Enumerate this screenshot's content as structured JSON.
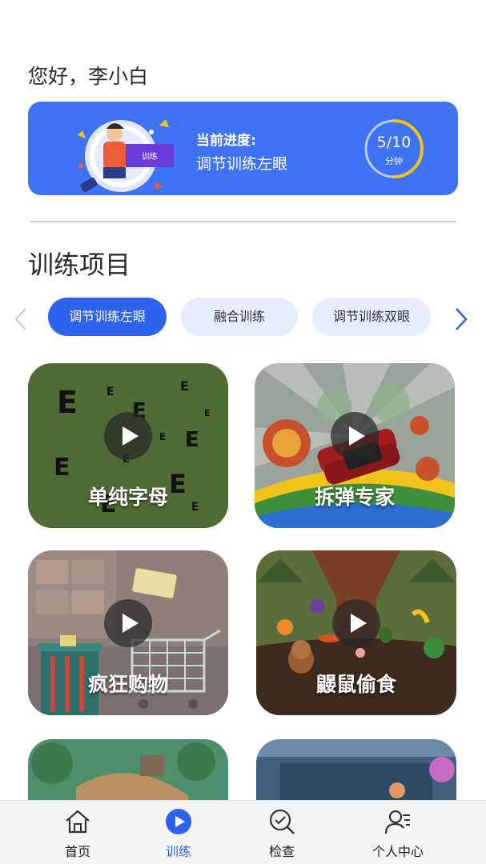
{
  "greeting": "您好，李小白",
  "progress_card": {
    "illustration_tag": "训练",
    "label": "当前进度:",
    "current_training": "调节训练左眼",
    "count": "5/10",
    "unit": "分钟",
    "completed_fraction": 0.5
  },
  "section_title": "训练项目",
  "categories": [
    {
      "label": "调节训练左眼",
      "active": true
    },
    {
      "label": "融合训练",
      "active": false
    },
    {
      "label": "调节训练双眼",
      "active": false
    }
  ],
  "games": [
    {
      "title": "单纯字母"
    },
    {
      "title": "拆弹专家"
    },
    {
      "title": "疯狂购物"
    },
    {
      "title": "鼹鼠偷食"
    },
    {
      "title": ""
    },
    {
      "title": ""
    }
  ],
  "tabbar": [
    {
      "label": "首页",
      "icon": "home-icon",
      "active": false
    },
    {
      "label": "训练",
      "icon": "play-icon",
      "active": true
    },
    {
      "label": "检查",
      "icon": "search-check-icon",
      "active": false
    },
    {
      "label": "个人中心",
      "icon": "user-icon",
      "active": false
    }
  ],
  "colors": {
    "primary": "#2e63ee",
    "card_blue": "#3f73f5",
    "chip_inactive": "#e4ecfd",
    "ring_accent": "#f5c21b"
  }
}
